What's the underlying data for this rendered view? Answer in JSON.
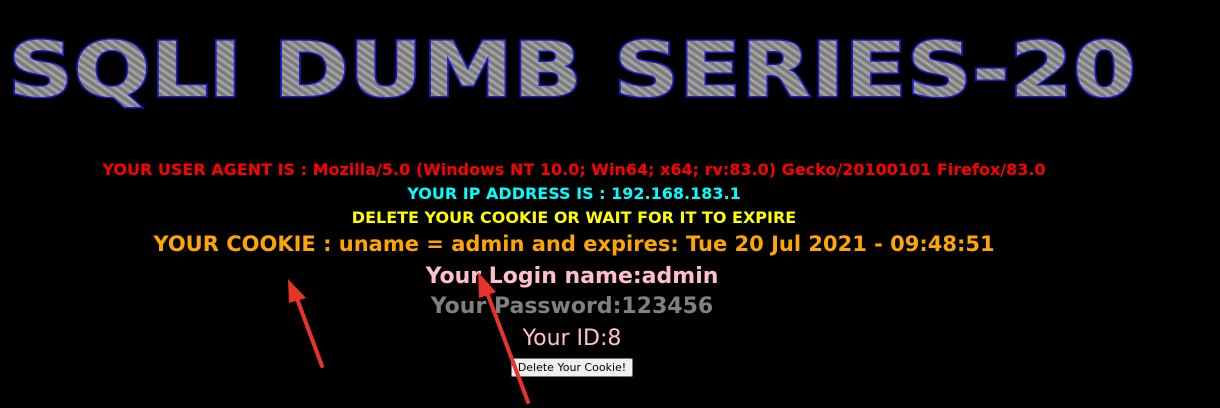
{
  "page": {
    "title": "SQLI DUMB SERIES-20"
  },
  "info": {
    "user_agent": "YOUR USER AGENT IS : Mozilla/5.0 (Windows NT 10.0; Win64; x64; rv:83.0) Gecko/20100101 Firefox/83.0",
    "ip_address": "YOUR IP ADDRESS IS : 192.168.183.1",
    "delete_message": "DELETE YOUR COOKIE OR WAIT FOR IT TO EXPIRE",
    "cookie": "YOUR COOKIE : uname = admin and expires: Tue 20 Jul 2021 - 09:48:51",
    "login_name": "Your Login name:admin",
    "password": "Your Password:123456",
    "user_id": "Your ID:8"
  },
  "form": {
    "delete_button_label": "Delete Your Cookie!"
  },
  "colors": {
    "background": "#000000",
    "user_agent": "#ff0000",
    "ip_address": "#00ffff",
    "delete_message": "#ffff00",
    "cookie": "#ffa500",
    "login_name": "#ffc0cb",
    "password": "#808080",
    "user_id": "#ffc0cb",
    "annotation_arrow": "#e8332a"
  }
}
